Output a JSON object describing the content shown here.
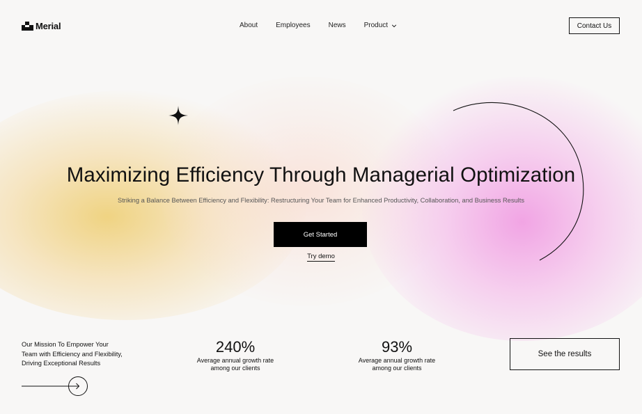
{
  "brand": {
    "name": "Merial",
    "icon": "merial-logo-icon"
  },
  "nav": {
    "items": [
      {
        "label": "About"
      },
      {
        "label": "Employees"
      },
      {
        "label": "News"
      },
      {
        "label": "Product",
        "icon": "chevron-down-icon"
      }
    ],
    "contact_label": "Contact Us"
  },
  "hero": {
    "title": "Maximizing Efficiency Through Managerial Optimization",
    "subtitle": "Striking a Balance Between Efficiency and Flexibility: Restructuring Your Team for Enhanced Productivity, Collaboration, and Business Results",
    "cta_label": "Get Started",
    "demo_label": "Try demo"
  },
  "bottom": {
    "mission_lines": [
      "Our Mission To Empower Your",
      "Team with Efficiency and Flexibility,",
      "Driving Exceptional Results"
    ],
    "stats": [
      {
        "value": "240%",
        "caption_lines": [
          "Average annual growth rate",
          "among our clients"
        ]
      },
      {
        "value": "93%",
        "caption_lines": [
          "Average annual growth rate",
          "among our clients"
        ]
      }
    ],
    "results_label": "See the results"
  },
  "colors": {
    "accent_black": "#000000",
    "background": "#f8f7f6",
    "gradient_yellow": "#eecd6e",
    "gradient_pink": "#f096e1"
  }
}
